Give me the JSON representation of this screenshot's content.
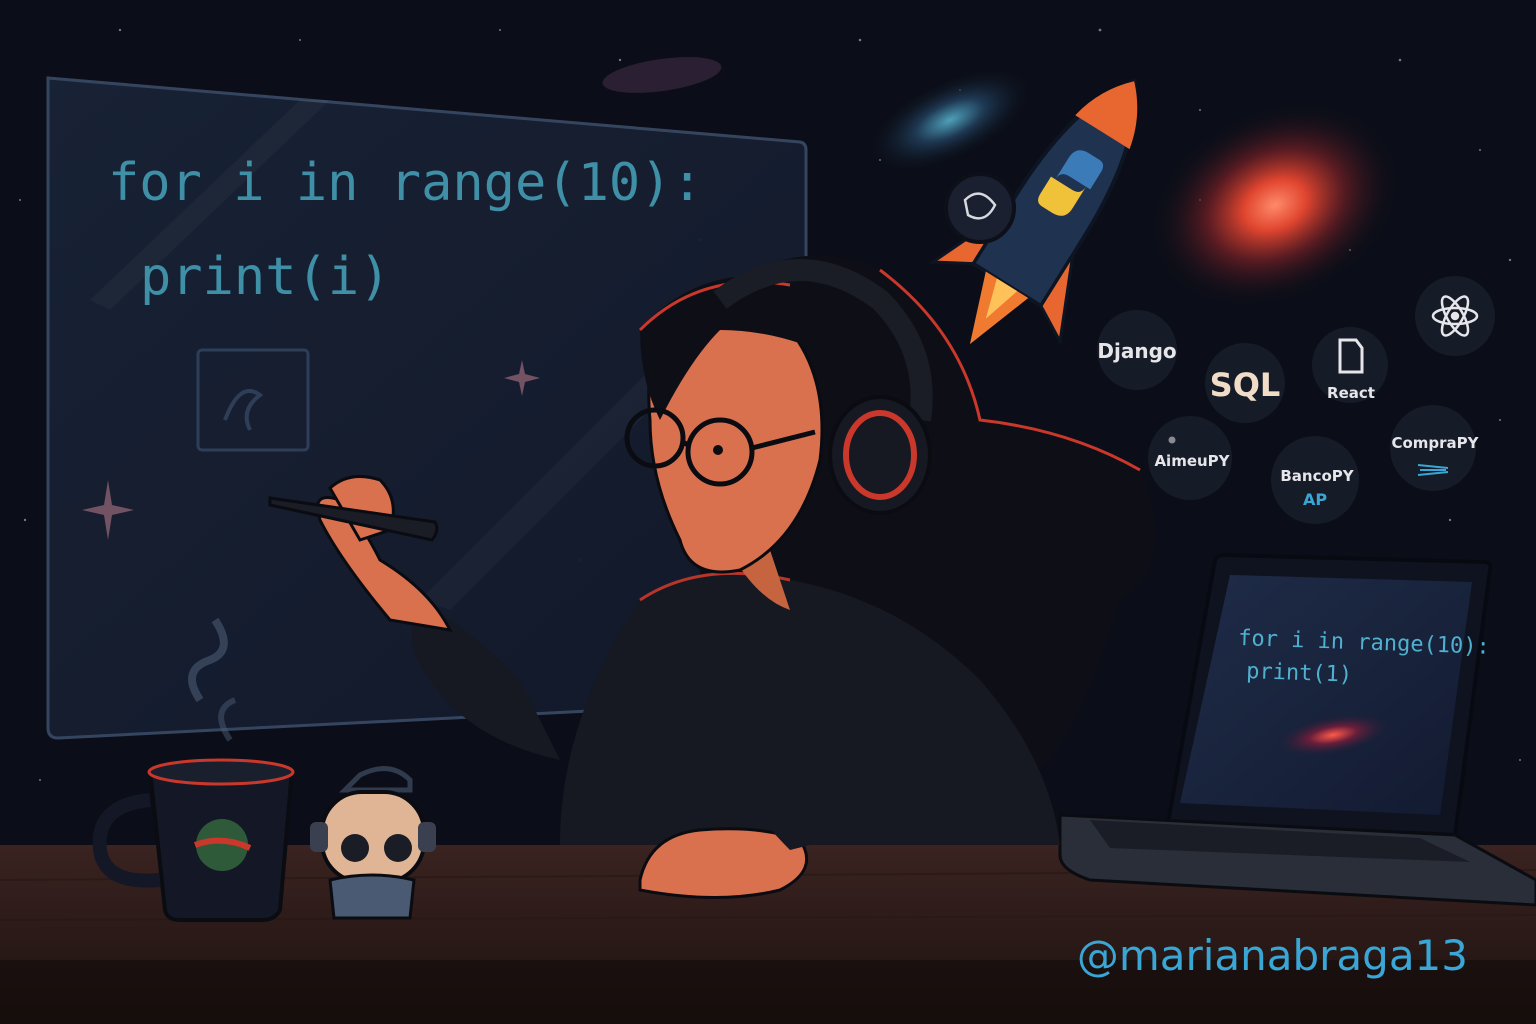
{
  "board": {
    "code_line_1": "for i in range(10):",
    "code_line_2": "print(i)"
  },
  "laptop": {
    "code_line_1": "for i in range(10):",
    "code_line_2": "print(1)"
  },
  "badges": {
    "django": "Django",
    "sql": "SQL",
    "react": "React",
    "aimeupy": "AimeuPY",
    "bancopy": "BancoPY",
    "bancopy_sub": "AP",
    "comprapy": "CompraPY"
  },
  "handle": "@marianabraga13",
  "colors": {
    "background": "#0b0e18",
    "code": "#3f8fa6",
    "accent_red": "#e0452f",
    "skin": "#d9714f",
    "handle": "#3aa6d6"
  },
  "icons": [
    "python-logo-icon",
    "atom-react-icon",
    "document-icon",
    "arrows-icon",
    "galaxy-icon",
    "rocket-icon"
  ]
}
